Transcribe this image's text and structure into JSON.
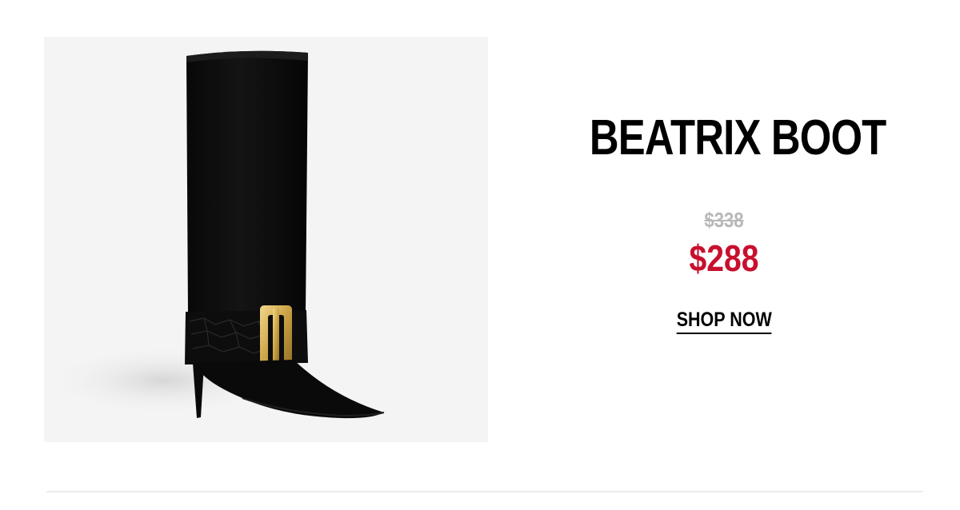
{
  "product": {
    "title": "BEATRIX BOOT",
    "original_price": "$338",
    "sale_price": "$288",
    "image_icon": "boot-product-image"
  },
  "cta": {
    "shop_now_label": "SHOP NOW"
  },
  "colors": {
    "sale_price": "#c8102e",
    "original_price": "#b8b8b8",
    "image_background": "#f4f4f4",
    "divider": "#ececec"
  }
}
